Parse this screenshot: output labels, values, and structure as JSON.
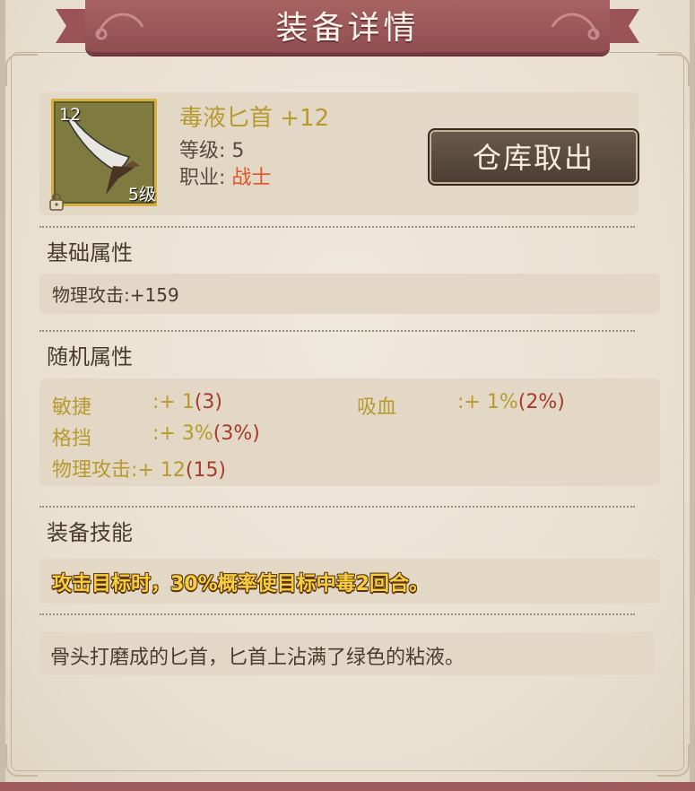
{
  "window": {
    "title": "装备详情"
  },
  "item": {
    "name": "毒液匕首 +12",
    "icon_level": "12",
    "icon_grade": "5级",
    "level_label": "等级:",
    "level_value": "5",
    "job_label": "职业:",
    "job_value": "战士",
    "icon": "dagger-icon",
    "locked_icon": "lock-icon"
  },
  "withdraw_button": {
    "label": "仓库取出"
  },
  "base_section": {
    "title": "基础属性",
    "line": "物理攻击:+159"
  },
  "random_section": {
    "title": "随机属性",
    "attrs": [
      {
        "name": "敏捷",
        "value": ":+ 1",
        "max": "(3)"
      },
      {
        "name": "吸血",
        "value": ":+ 1%",
        "max": "(2%)"
      },
      {
        "name": "格挡",
        "value": ":+ 3%",
        "max": "(3%)"
      },
      {
        "name": "物理攻击",
        "value": ":+ 12",
        "max": "(15)"
      }
    ]
  },
  "skill_section": {
    "title": "装备技能",
    "text": "攻击目标时，30%概率使目标中毒2回合。"
  },
  "description": {
    "text": "骨头打磨成的匕首，匕首上沾满了绿色的粘液。"
  },
  "colors": {
    "ribbon": "#9b5456",
    "gold_text": "#b89a30",
    "max_text": "#a83a2c",
    "job_text": "#e0552a",
    "skill_text": "#f6ce3e"
  }
}
